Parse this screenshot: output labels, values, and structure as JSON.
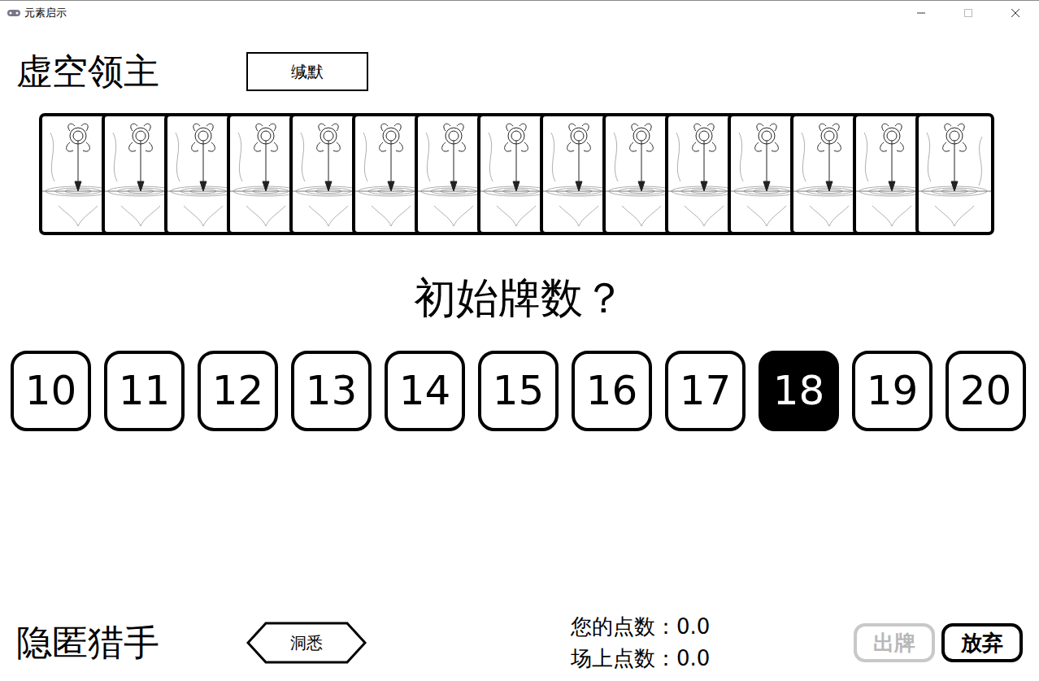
{
  "window": {
    "title": "元素启示"
  },
  "opponent": {
    "name": "虚空领主",
    "status": "缄默",
    "cards_in_hand": 15
  },
  "prompt": "初始牌数？",
  "choices": [
    {
      "label": "10",
      "selected": false
    },
    {
      "label": "11",
      "selected": false
    },
    {
      "label": "12",
      "selected": false
    },
    {
      "label": "13",
      "selected": false
    },
    {
      "label": "14",
      "selected": false
    },
    {
      "label": "15",
      "selected": false
    },
    {
      "label": "16",
      "selected": false
    },
    {
      "label": "17",
      "selected": false
    },
    {
      "label": "18",
      "selected": true
    },
    {
      "label": "19",
      "selected": false
    },
    {
      "label": "20",
      "selected": false
    }
  ],
  "player": {
    "name": "隐匿猎手",
    "status": "洞悉"
  },
  "scores": [
    {
      "label": "您的点数：",
      "value": "0.0"
    },
    {
      "label": "场上点数：",
      "value": "0.0"
    }
  ],
  "buttons": [
    {
      "label": "出牌",
      "disabled": true
    },
    {
      "label": "放弃",
      "disabled": false
    }
  ]
}
